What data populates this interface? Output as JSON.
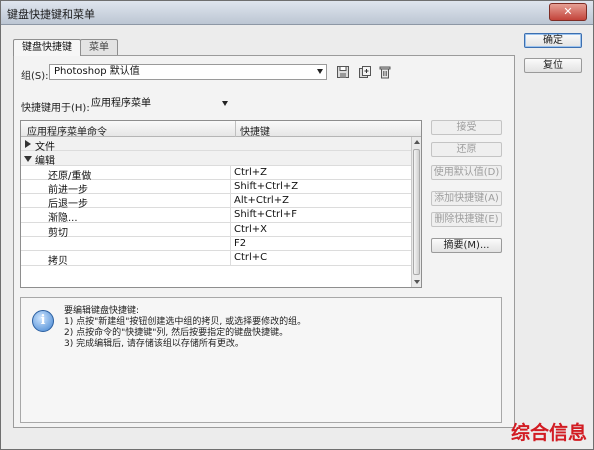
{
  "window": {
    "title": "键盘快捷键和菜单",
    "close_label": "✕"
  },
  "tabs": [
    {
      "label": "键盘快捷键"
    },
    {
      "label": "菜单"
    }
  ],
  "group": {
    "label": "组(S):",
    "value": "Photoshop 默认值"
  },
  "shortcuts_for": {
    "label": "快捷键用于(H):",
    "value": "应用程序菜单"
  },
  "table": {
    "headers": {
      "command": "应用程序菜单命令",
      "shortcut": "快捷键"
    },
    "rows": [
      {
        "type": "section",
        "expanded": false,
        "command": "文件",
        "shortcut": ""
      },
      {
        "type": "section",
        "expanded": true,
        "command": "编辑",
        "shortcut": ""
      },
      {
        "type": "item",
        "command": "还原/重做",
        "shortcut": "Ctrl+Z"
      },
      {
        "type": "item",
        "command": "前进一步",
        "shortcut": "Shift+Ctrl+Z"
      },
      {
        "type": "item",
        "command": "后退一步",
        "shortcut": "Alt+Ctrl+Z"
      },
      {
        "type": "item",
        "command": "渐隐...",
        "shortcut": "Shift+Ctrl+F"
      },
      {
        "type": "item",
        "command": "剪切",
        "shortcut": "Ctrl+X"
      },
      {
        "type": "item",
        "command": "",
        "shortcut": "F2"
      },
      {
        "type": "item",
        "command": "拷贝",
        "shortcut": "Ctrl+C"
      }
    ]
  },
  "side_buttons": {
    "accept": "接受",
    "undo": "还原",
    "use_default": "使用默认值(D)",
    "add_shortcut": "添加快捷键(A)",
    "delete_shortcut": "删除快捷键(E)",
    "summarize": "摘要(M)..."
  },
  "dialog_buttons": {
    "ok": "确定",
    "reset": "复位"
  },
  "info": {
    "lines": [
      "要编辑键盘快捷键:",
      "1) 点按\"新建组\"按钮创建选中组的拷贝, 或选择要修改的组。",
      "2) 点按命令的\"快捷键\"列, 然后按要指定的键盘快捷键。",
      "3) 完成编辑后, 请存储该组以存储所有更改。"
    ]
  },
  "watermark": "综合信息"
}
